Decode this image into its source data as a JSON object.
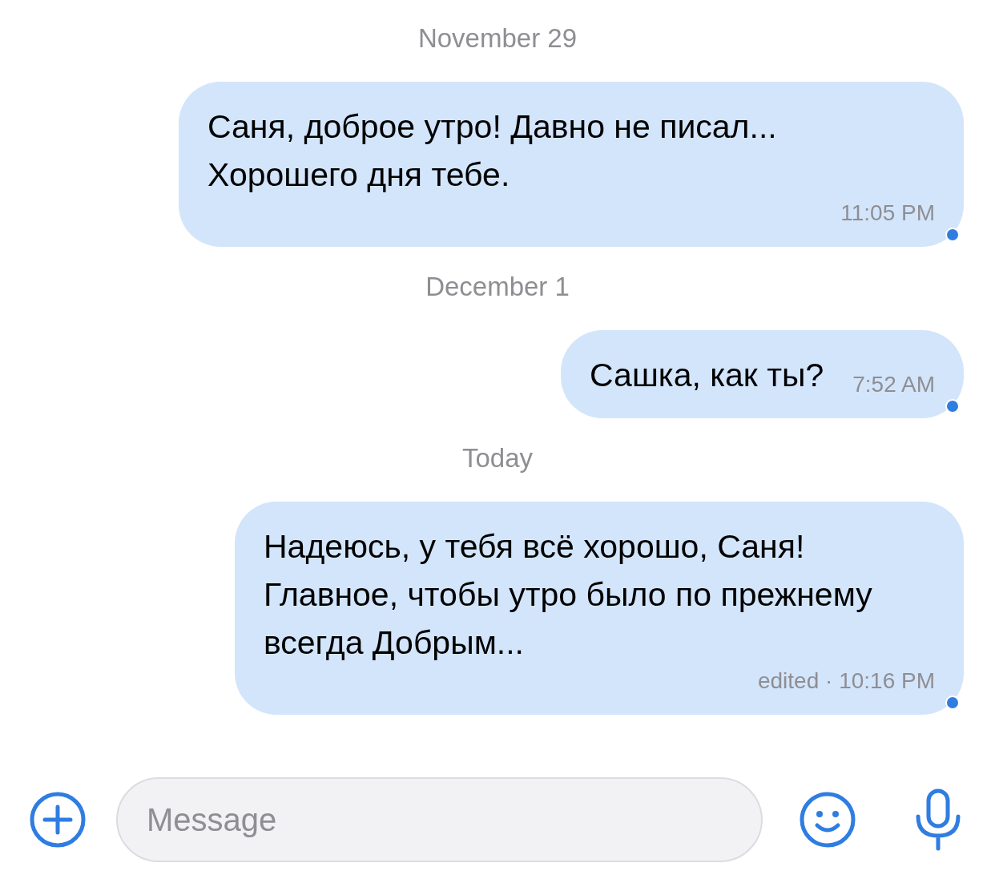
{
  "conversation": [
    {
      "kind": "date",
      "label": "November 29"
    },
    {
      "kind": "message",
      "text": "Саня, доброе утро! Давно не писал... Хорошего дня тебе.",
      "meta": "11:05 PM",
      "unread": true
    },
    {
      "kind": "date",
      "label": "December 1"
    },
    {
      "kind": "message",
      "text": "Сашка, как ты?",
      "meta": "7:52 AM",
      "unread": true
    },
    {
      "kind": "date",
      "label": "Today"
    },
    {
      "kind": "message",
      "text": "Надеюсь, у тебя всё хорошо, Саня! Главное, чтобы утро было по прежнему всегда Добрым...",
      "meta": "edited · 10:16 PM",
      "unread": true
    }
  ],
  "composer": {
    "placeholder": "Message"
  }
}
